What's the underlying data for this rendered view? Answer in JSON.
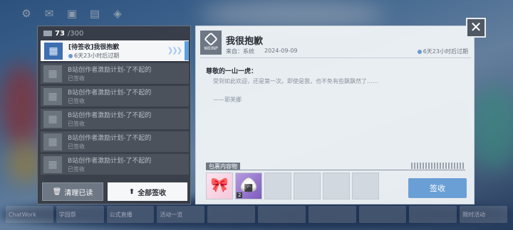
{
  "background": {
    "bottom_strip": [
      "ChatWork",
      "学园祭",
      "公式直播",
      "活动一览",
      "",
      "",
      "",
      "",
      "",
      "限时活动",
      "",
      "",
      "",
      ""
    ]
  },
  "topbar_icons": [
    "gear-icon",
    "mail-icon",
    "notice-icon",
    "calendar-icon",
    "gift-icon"
  ],
  "mail_panel": {
    "count": "73",
    "total": "/300",
    "items": [
      {
        "title": "[待签收]我很抱歉",
        "sub": "6天23小时后过期",
        "active": true
      },
      {
        "title": "B站创作者激励计划-了不起的",
        "sub": "已签收",
        "active": false
      },
      {
        "title": "B站创作者激励计划-了不起的",
        "sub": "已签收",
        "active": false
      },
      {
        "title": "B站创作者激励计划-了不起的",
        "sub": "已签收",
        "active": false
      },
      {
        "title": "B站创作者激励计划-了不起的",
        "sub": "已签收",
        "active": false
      },
      {
        "title": "B站创作者激励计划-了不起的",
        "sub": "已签收",
        "active": false
      }
    ],
    "clear_label": "清理已读",
    "claim_all_label": "全部签收"
  },
  "detail": {
    "logo_text": "WEINP",
    "title": "我很抱歉",
    "from": "来自：系统",
    "date": "2024-09-09",
    "expire": "6天23小时后过期",
    "greeting": "尊敬的一山一虎：",
    "body": "受到如此欢迎，还是第一次。即使是我，也不免有些飘飘然了……",
    "signature": "——耶芙娜",
    "attachment_label": "包裹内容物",
    "attachments": [
      {
        "name": "character-gift",
        "qty": ""
      },
      {
        "name": "lucky-charm",
        "qty": "2"
      },
      {
        "name": "",
        "qty": ""
      },
      {
        "name": "",
        "qty": ""
      },
      {
        "name": "",
        "qty": ""
      },
      {
        "name": "",
        "qty": ""
      }
    ],
    "claim_label": "签收"
  },
  "colors": {
    "accent": "#6a9fd6",
    "panel_dark": "#373c44",
    "panel_light": "#eef2f6"
  }
}
